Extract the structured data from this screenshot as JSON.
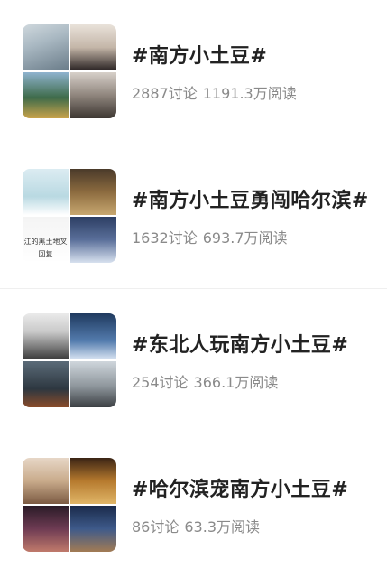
{
  "topics": [
    {
      "title": "#南方小土豆#",
      "discussions": "2887讨论",
      "reads": "1191.3万阅读"
    },
    {
      "title": "#南方小土豆勇闯哈尔滨#",
      "discussions": "1632讨论",
      "reads": "693.7万阅读",
      "thumb_caption_1": "江的黑土地叉",
      "thumb_caption_2": "回复"
    },
    {
      "title": "#东北人玩南方小土豆#",
      "discussions": "254讨论",
      "reads": "366.1万阅读"
    },
    {
      "title": "#哈尔滨宠南方小土豆#",
      "discussions": "86讨论",
      "reads": "63.3万阅读"
    }
  ],
  "colors": {
    "title": "#222222",
    "stats": "#8a8a8a",
    "divider": "#efefef"
  }
}
